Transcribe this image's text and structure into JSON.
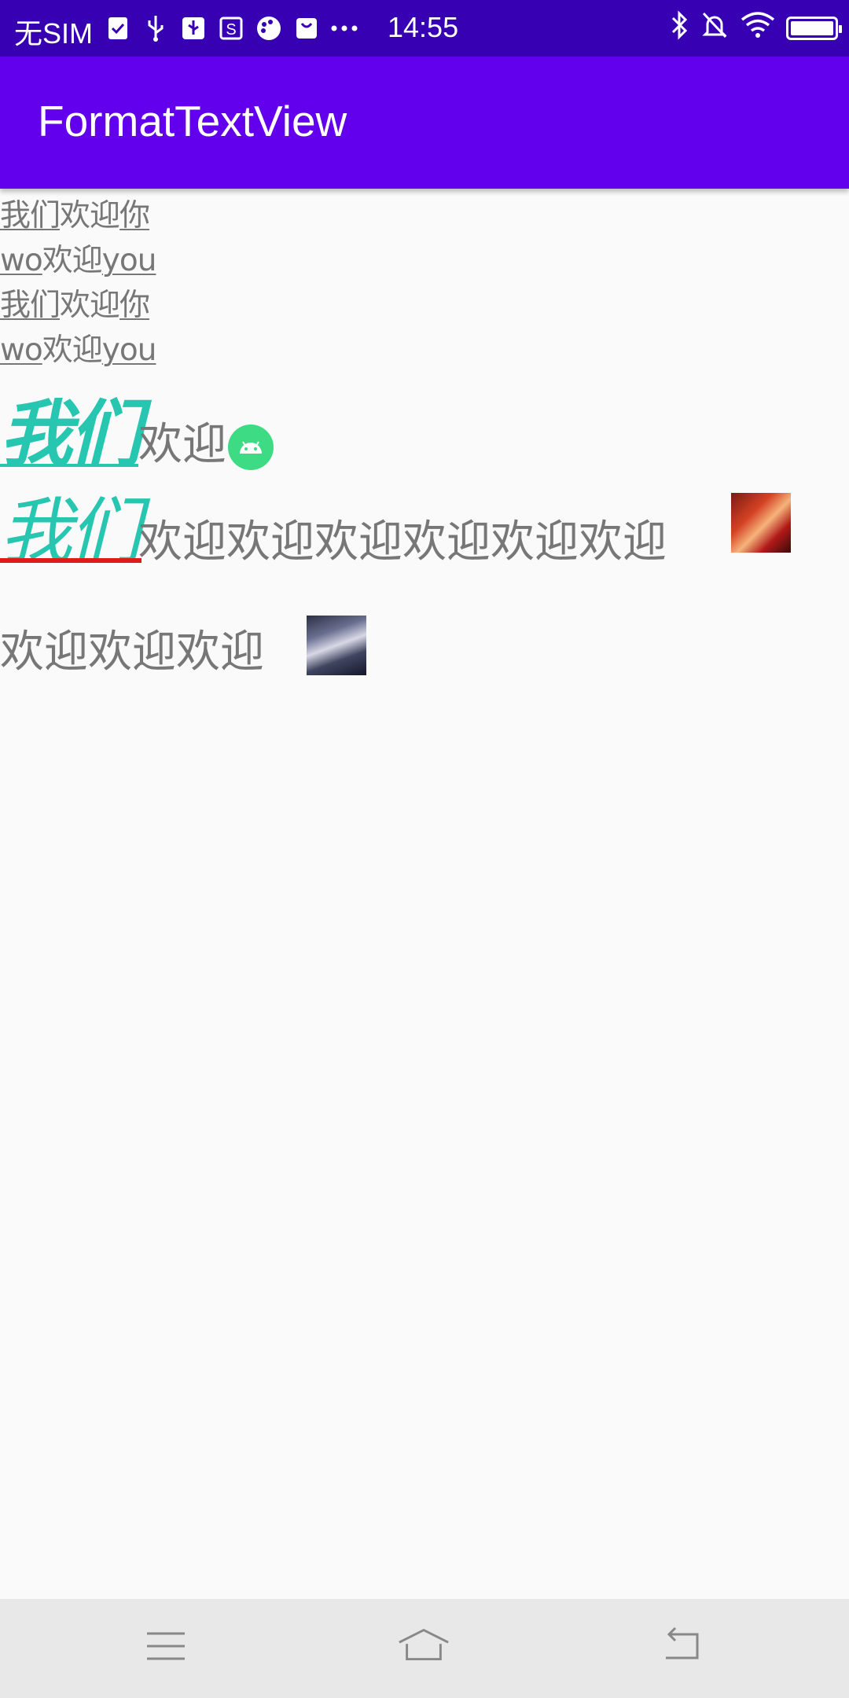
{
  "status_bar": {
    "carrier": "无SIM",
    "time": "14:55",
    "left_icons": [
      "check-icon",
      "usb-icon",
      "usb-debug-icon",
      "sync-icon",
      "palette-icon",
      "bag-icon",
      "more-dots-icon"
    ],
    "right_icons": [
      "bluetooth-icon",
      "muted-bell-icon",
      "wifi-icon",
      "battery-icon"
    ]
  },
  "app_bar": {
    "title": "FormatTextView"
  },
  "content": {
    "line1": {
      "part1": "我们",
      "part2": "欢迎",
      "part3": "你"
    },
    "line2": {
      "part1": "wo",
      "part2": "欢迎",
      "part3": "you"
    },
    "line3": {
      "part1": "我们",
      "part2": "欢迎",
      "part3": "你"
    },
    "line4": {
      "part1": "wo",
      "part2": "欢迎",
      "part3": "you"
    },
    "line5": {
      "emph": "我们",
      "rest": "欢迎"
    },
    "line6": {
      "emph": "我们",
      "rest": "欢迎欢迎欢迎欢迎欢迎欢迎"
    },
    "line7": {
      "rest": "欢迎欢迎欢迎"
    }
  },
  "colors": {
    "status_bar": "#3700b3",
    "app_bar": "#6200ee",
    "accent_text": "#26c6b0",
    "underline_red": "#e01919",
    "body_text": "#777777"
  },
  "nav_bar": {
    "buttons": [
      "menu-icon",
      "home-icon",
      "back-icon"
    ]
  }
}
